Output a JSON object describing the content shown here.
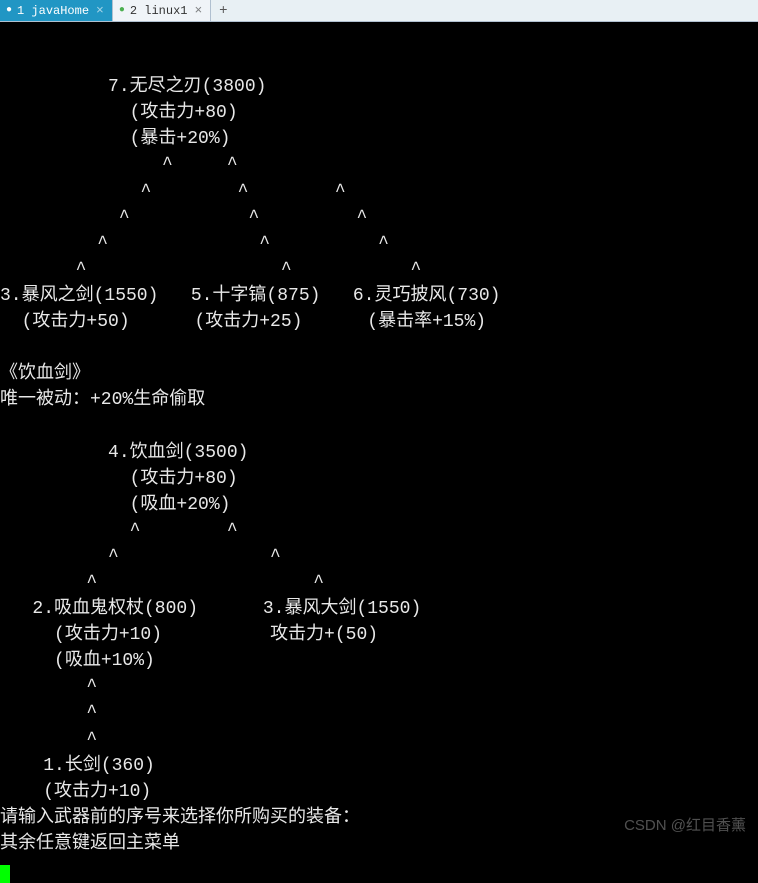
{
  "tabs": {
    "items": [
      {
        "label": "1 javaHome",
        "active": true
      },
      {
        "label": "2 linux1",
        "active": false
      }
    ]
  },
  "tree1": {
    "top": {
      "line1": "7.无尽之刃(3800)",
      "line2": "(攻击力+80)",
      "line3": "(暴击+20%)"
    },
    "left": {
      "line1": "3.暴风之剑(1550)",
      "line2": "(攻击力+50)"
    },
    "mid": {
      "line1": "5.十字镐(875)",
      "line2": "(攻击力+25)"
    },
    "right": {
      "line1": "6.灵巧披风(730)",
      "line2": "(暴击率+15%)"
    }
  },
  "section2": {
    "title": "《饮血剑》",
    "passive": "唯一被动：+20%生命偷取"
  },
  "tree2": {
    "top": {
      "line1": "4.饮血剑(3500)",
      "line2": "(攻击力+80)",
      "line3": "(吸血+20%)"
    },
    "left": {
      "line1": "2.吸血鬼权杖(800)",
      "line2": "(攻击力+10)",
      "line3": "(吸血+10%)"
    },
    "right": {
      "line1": "3.暴风大剑(1550)",
      "line2": "攻击力+(50)"
    },
    "bottom": {
      "line1": "1.长剑(360)",
      "line2": "(攻击力+10)"
    }
  },
  "prompt": {
    "line1": "请输入武器前的序号来选择你所购买的装备：",
    "line2": "其余任意键返回主菜单"
  },
  "carets": {
    "c2": "^     ^",
    "c3": "^        ^",
    "c4": "^           ^",
    "c5": "^              ^",
    "c6": "^                  ^",
    "single": "^"
  },
  "watermark": "CSDN @红目香薰"
}
